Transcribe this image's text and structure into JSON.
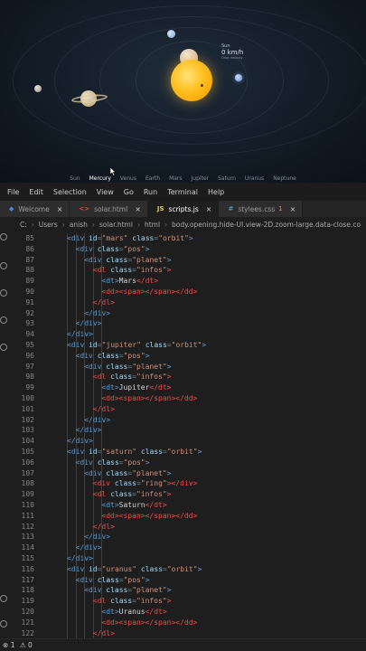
{
  "preview": {
    "info": {
      "name": "Sun",
      "speed": "0 km/h",
      "sub": "Orbit Velocity"
    },
    "planets": [
      "Sun",
      "Mercury",
      "Venus",
      "Earth",
      "Mars",
      "Jupiter",
      "Saturn",
      "Uranus",
      "Neptune"
    ],
    "active_planet": "Mercury"
  },
  "menu": [
    "File",
    "Edit",
    "Selection",
    "View",
    "Go",
    "Run",
    "Terminal",
    "Help"
  ],
  "tabs": [
    {
      "label": "Welcome",
      "icon": "vscode-icon",
      "glyph": "◆",
      "color": "#3b8eea"
    },
    {
      "label": "solar.html",
      "icon": "html-icon",
      "glyph": "<>",
      "color": "#e44d26"
    },
    {
      "label": "scripts.js",
      "icon": "js-icon",
      "glyph": "JS",
      "color": "#e8c94c",
      "active": true
    },
    {
      "label": "stylees.css",
      "icon": "css-icon",
      "glyph": "#",
      "color": "#519aba",
      "badge": "1"
    }
  ],
  "breadcrumb": [
    "C:",
    "Users",
    "anish",
    "solar.html",
    "html",
    "body.opening.hide-UI.view-2D.zoom-large.data-close.co"
  ],
  "code_lines": [
    {
      "n": "85",
      "i": 1,
      "tokens": [
        [
          "tg",
          "<div "
        ],
        [
          "at",
          "id"
        ],
        [
          "pn",
          "="
        ],
        [
          "st",
          "\"mars\" "
        ],
        [
          "at",
          "class"
        ],
        [
          "pn",
          "="
        ],
        [
          "st",
          "\"orbit\""
        ],
        [
          "tg",
          ">"
        ]
      ]
    },
    {
      "n": "86",
      "i": 2,
      "tokens": [
        [
          "tg",
          "<div "
        ],
        [
          "at",
          "class"
        ],
        [
          "pn",
          "="
        ],
        [
          "st",
          "\"pos\""
        ],
        [
          "tg",
          ">"
        ]
      ]
    },
    {
      "n": "87",
      "i": 3,
      "tokens": [
        [
          "tg",
          "<div "
        ],
        [
          "at",
          "class"
        ],
        [
          "pn",
          "="
        ],
        [
          "st",
          "\"planet\""
        ],
        [
          "tg",
          ">"
        ]
      ]
    },
    {
      "n": "88",
      "i": 4,
      "tokens": [
        [
          "tgr",
          "<dl "
        ],
        [
          "at",
          "class"
        ],
        [
          "pn",
          "="
        ],
        [
          "st",
          "\"infos\""
        ],
        [
          "tgr",
          ">"
        ]
      ]
    },
    {
      "n": "89",
      "i": 5,
      "tokens": [
        [
          "tg",
          "<dt"
        ],
        [
          "tg",
          ">"
        ],
        [
          "tx",
          "Mars"
        ],
        [
          "tgr",
          "</dt>"
        ]
      ]
    },
    {
      "n": "90",
      "i": 5,
      "tokens": [
        [
          "tgr",
          "<dd"
        ],
        [
          "tgr",
          ">"
        ],
        [
          "tgr",
          "<span>"
        ],
        [
          "tgr",
          "</span>"
        ],
        [
          "tgr",
          "</dd>"
        ]
      ]
    },
    {
      "n": "91",
      "i": 4,
      "tokens": [
        [
          "tgr",
          "</dl>"
        ]
      ]
    },
    {
      "n": "92",
      "i": 3,
      "tokens": [
        [
          "tg",
          "</div>"
        ]
      ]
    },
    {
      "n": "93",
      "i": 2,
      "tokens": [
        [
          "tg",
          "</div>"
        ]
      ]
    },
    {
      "n": "94",
      "i": 1,
      "tokens": [
        [
          "tg",
          "</div>"
        ]
      ]
    },
    {
      "n": "95",
      "i": 1,
      "tokens": [
        [
          "tg",
          "<div "
        ],
        [
          "at",
          "id"
        ],
        [
          "pn",
          "="
        ],
        [
          "st",
          "\"jupiter\" "
        ],
        [
          "at",
          "class"
        ],
        [
          "pn",
          "="
        ],
        [
          "st",
          "\"orbit\""
        ],
        [
          "tg",
          ">"
        ]
      ]
    },
    {
      "n": "96",
      "i": 2,
      "tokens": [
        [
          "tg",
          "<div "
        ],
        [
          "at",
          "class"
        ],
        [
          "pn",
          "="
        ],
        [
          "st",
          "\"pos\""
        ],
        [
          "tg",
          ">"
        ]
      ]
    },
    {
      "n": "97",
      "i": 3,
      "tokens": [
        [
          "tg",
          "<div "
        ],
        [
          "at",
          "class"
        ],
        [
          "pn",
          "="
        ],
        [
          "st",
          "\"planet\""
        ],
        [
          "tg",
          ">"
        ]
      ]
    },
    {
      "n": "98",
      "i": 4,
      "tokens": [
        [
          "tgr",
          "<dl "
        ],
        [
          "at",
          "class"
        ],
        [
          "pn",
          "="
        ],
        [
          "st",
          "\"infos\""
        ],
        [
          "tgr",
          ">"
        ]
      ]
    },
    {
      "n": "99",
      "i": 5,
      "tokens": [
        [
          "tg",
          "<dt"
        ],
        [
          "tg",
          ">"
        ],
        [
          "tx",
          "Jupiter"
        ],
        [
          "tgr",
          "</dt>"
        ]
      ]
    },
    {
      "n": "100",
      "i": 5,
      "tokens": [
        [
          "tgr",
          "<dd"
        ],
        [
          "tgr",
          ">"
        ],
        [
          "tgr",
          "<span>"
        ],
        [
          "tgr",
          "</span>"
        ],
        [
          "tgr",
          "</dd>"
        ]
      ]
    },
    {
      "n": "101",
      "i": 4,
      "tokens": [
        [
          "tgr",
          "</dl>"
        ]
      ]
    },
    {
      "n": "102",
      "i": 3,
      "tokens": [
        [
          "tg",
          "</div>"
        ]
      ]
    },
    {
      "n": "103",
      "i": 2,
      "tokens": [
        [
          "tg",
          "</div>"
        ]
      ]
    },
    {
      "n": "104",
      "i": 1,
      "tokens": [
        [
          "tg",
          "</div>"
        ]
      ]
    },
    {
      "n": "105",
      "i": 1,
      "tokens": [
        [
          "tg",
          "<div "
        ],
        [
          "at",
          "id"
        ],
        [
          "pn",
          "="
        ],
        [
          "st",
          "\"saturn\" "
        ],
        [
          "at",
          "class"
        ],
        [
          "pn",
          "="
        ],
        [
          "st",
          "\"orbit\""
        ],
        [
          "tg",
          ">"
        ]
      ]
    },
    {
      "n": "106",
      "i": 2,
      "tokens": [
        [
          "tg",
          "<div "
        ],
        [
          "at",
          "class"
        ],
        [
          "pn",
          "="
        ],
        [
          "st",
          "\"pos\""
        ],
        [
          "tg",
          ">"
        ]
      ]
    },
    {
      "n": "107",
      "i": 3,
      "tokens": [
        [
          "tg",
          "<div "
        ],
        [
          "at",
          "class"
        ],
        [
          "pn",
          "="
        ],
        [
          "st",
          "\"planet\""
        ],
        [
          "tg",
          ">"
        ]
      ]
    },
    {
      "n": "108",
      "i": 4,
      "tokens": [
        [
          "tgr",
          "<div "
        ],
        [
          "at",
          "class"
        ],
        [
          "pn",
          "="
        ],
        [
          "st",
          "\"ring\""
        ],
        [
          "tgr",
          ">"
        ],
        [
          "tgr",
          "</div>"
        ]
      ]
    },
    {
      "n": "109",
      "i": 4,
      "tokens": [
        [
          "tgr",
          "<dl "
        ],
        [
          "at",
          "class"
        ],
        [
          "pn",
          "="
        ],
        [
          "st",
          "\"infos\""
        ],
        [
          "tgr",
          ">"
        ]
      ]
    },
    {
      "n": "110",
      "i": 5,
      "tokens": [
        [
          "tg",
          "<dt"
        ],
        [
          "tg",
          ">"
        ],
        [
          "tx",
          "Saturn"
        ],
        [
          "tgr",
          "</dt>"
        ]
      ]
    },
    {
      "n": "111",
      "i": 5,
      "tokens": [
        [
          "tgr",
          "<dd"
        ],
        [
          "tgr",
          ">"
        ],
        [
          "tgr",
          "<span>"
        ],
        [
          "tgr",
          "</span>"
        ],
        [
          "tgr",
          "</dd>"
        ]
      ]
    },
    {
      "n": "112",
      "i": 4,
      "tokens": [
        [
          "tgr",
          "</dl>"
        ]
      ]
    },
    {
      "n": "113",
      "i": 3,
      "tokens": [
        [
          "tg",
          "</div>"
        ]
      ]
    },
    {
      "n": "114",
      "i": 2,
      "tokens": [
        [
          "tg",
          "</div>"
        ]
      ]
    },
    {
      "n": "115",
      "i": 1,
      "tokens": [
        [
          "tg",
          "</div>"
        ]
      ]
    },
    {
      "n": "116",
      "i": 1,
      "tokens": [
        [
          "tg",
          "<div "
        ],
        [
          "at",
          "id"
        ],
        [
          "pn",
          "="
        ],
        [
          "st",
          "\"uranus\" "
        ],
        [
          "at",
          "class"
        ],
        [
          "pn",
          "="
        ],
        [
          "st",
          "\"orbit\""
        ],
        [
          "tg",
          ">"
        ]
      ]
    },
    {
      "n": "117",
      "i": 2,
      "tokens": [
        [
          "tg",
          "<div "
        ],
        [
          "at",
          "class"
        ],
        [
          "pn",
          "="
        ],
        [
          "st",
          "\"pos\""
        ],
        [
          "tg",
          ">"
        ]
      ]
    },
    {
      "n": "118",
      "i": 3,
      "tokens": [
        [
          "tg",
          "<div "
        ],
        [
          "at",
          "class"
        ],
        [
          "pn",
          "="
        ],
        [
          "st",
          "\"planet\""
        ],
        [
          "tg",
          ">"
        ]
      ]
    },
    {
      "n": "119",
      "i": 4,
      "tokens": [
        [
          "tgr",
          "<dl "
        ],
        [
          "at",
          "class"
        ],
        [
          "pn",
          "="
        ],
        [
          "st",
          "\"infos\""
        ],
        [
          "tgr",
          ">"
        ]
      ]
    },
    {
      "n": "120",
      "i": 5,
      "tokens": [
        [
          "tg",
          "<dt"
        ],
        [
          "tg",
          ">"
        ],
        [
          "tx",
          "Uranus"
        ],
        [
          "tgr",
          "</dt>"
        ]
      ]
    },
    {
      "n": "121",
      "i": 5,
      "tokens": [
        [
          "tgr",
          "<dd"
        ],
        [
          "tgr",
          ">"
        ],
        [
          "tgr",
          "<span>"
        ],
        [
          "tgr",
          "</span>"
        ],
        [
          "tgr",
          "</dd>"
        ]
      ]
    },
    {
      "n": "122",
      "i": 4,
      "tokens": [
        [
          "tgr",
          "</dl>"
        ]
      ]
    }
  ],
  "status": {
    "problems": "1",
    "warnings": "0"
  }
}
